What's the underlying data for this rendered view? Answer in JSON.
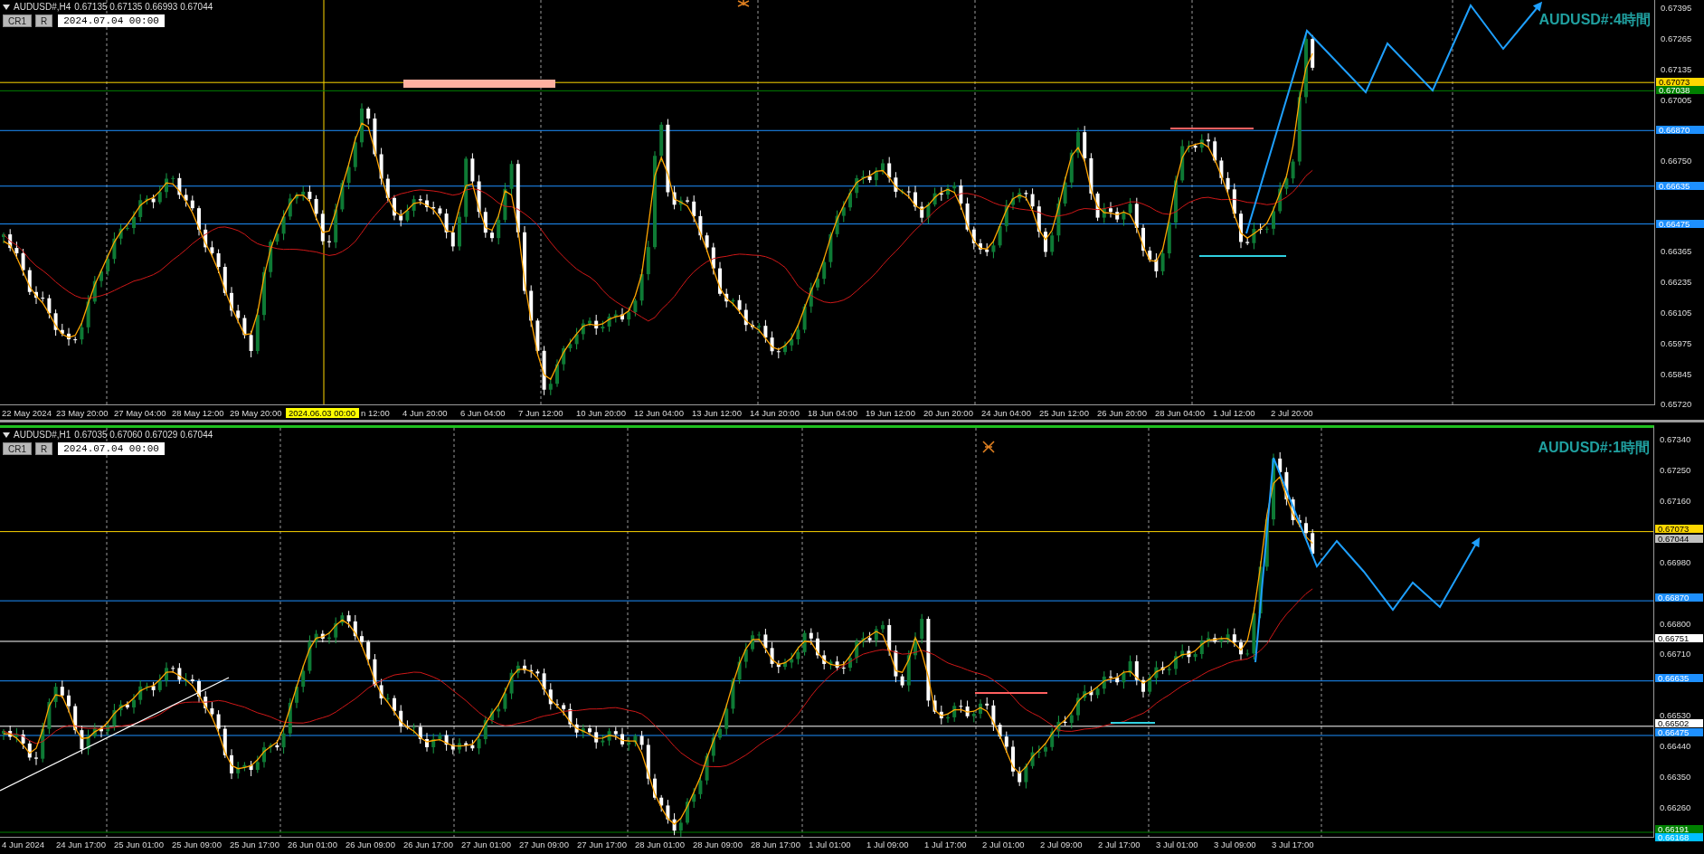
{
  "panels": [
    {
      "symbol": "AUDUSD#,H4",
      "ohlc": "0.67135 0.67135 0.66993 0.67044",
      "buttons": [
        "CR1",
        "R"
      ],
      "date_field": "2024.07.04 00:00",
      "title": "AUDUSD#:4時間",
      "price_ticks": [
        "0.67395",
        "0.67265",
        "0.67135",
        "0.67005",
        "0.66750",
        "0.66365",
        "0.66235",
        "0.66105",
        "0.65975",
        "0.65845",
        "0.65720"
      ],
      "price_labels": [
        {
          "value": "0.67073",
          "color": "#ffd700",
          "kind": "level"
        },
        {
          "value": "0.67038",
          "color": "#008000",
          "kind": "level"
        },
        {
          "value": "0.66870",
          "color": "#1e90ff",
          "kind": "level"
        },
        {
          "value": "0.66635",
          "color": "#1e90ff",
          "kind": "level"
        },
        {
          "value": "0.66475",
          "color": "#1e90ff",
          "kind": "level"
        }
      ],
      "time_labels": [
        {
          "text": "22 May 2024",
          "kind": "first"
        },
        {
          "text": "23 May 20:00",
          "kind": "date"
        },
        {
          "text": "27 May 04:00",
          "kind": "date"
        },
        {
          "text": "28 May 12:00",
          "kind": "date"
        },
        {
          "text": "29 May 20:00",
          "kind": "date"
        },
        {
          "text": "2024.06.03 00:00",
          "kind": "crosshair"
        },
        {
          "text": "n 12:00",
          "kind": "partial"
        },
        {
          "text": "4 Jun 20:00",
          "kind": "date"
        },
        {
          "text": "6 Jun 04:00",
          "kind": "date"
        },
        {
          "text": "7 Jun 12:00",
          "kind": "date"
        },
        {
          "text": "10 Jun 20:00",
          "kind": "date"
        },
        {
          "text": "12 Jun 04:00",
          "kind": "date"
        },
        {
          "text": "13 Jun 12:00",
          "kind": "date"
        },
        {
          "text": "14 Jun 20:00",
          "kind": "date"
        },
        {
          "text": "18 Jun 04:00",
          "kind": "date"
        },
        {
          "text": "19 Jun 12:00",
          "kind": "date"
        },
        {
          "text": "20 Jun 20:00",
          "kind": "date"
        },
        {
          "text": "24 Jun 04:00",
          "kind": "date"
        },
        {
          "text": "25 Jun 12:00",
          "kind": "date"
        },
        {
          "text": "26 Jun 20:00",
          "kind": "date"
        },
        {
          "text": "28 Jun 04:00",
          "kind": "date"
        },
        {
          "text": "1 Jul 12:00",
          "kind": "date"
        },
        {
          "text": "2 Jul 20:00",
          "kind": "date"
        }
      ]
    },
    {
      "symbol": "AUDUSD#,H1",
      "ohlc": "0.67035 0.67060 0.67029 0.67044",
      "buttons": [
        "CR1",
        "R"
      ],
      "date_field": "2024.07.04 00:00",
      "title": "AUDUSD#:1時間",
      "price_ticks": [
        "0.67340",
        "0.67250",
        "0.67160",
        "0.66980",
        "0.66800",
        "0.66710",
        "0.66530",
        "0.66440",
        "0.66350",
        "0.66260"
      ],
      "price_labels": [
        {
          "value": "0.67073",
          "color": "#ffd700",
          "kind": "level"
        },
        {
          "value": "0.67044",
          "color": "#c0c0c0",
          "kind": "marker"
        },
        {
          "value": "0.66870",
          "color": "#1e90ff",
          "kind": "level"
        },
        {
          "value": "0.66751",
          "color": "#ffffff",
          "kind": "level"
        },
        {
          "value": "0.66635",
          "color": "#1e90ff",
          "kind": "level"
        },
        {
          "value": "0.66502",
          "color": "#ffffff",
          "kind": "level"
        },
        {
          "value": "0.66475",
          "color": "#1e90ff",
          "kind": "level"
        },
        {
          "value": "0.66191",
          "color": "#008000",
          "kind": "level"
        },
        {
          "value": "0.66168",
          "color": "#00bfff",
          "kind": "level"
        }
      ],
      "time_labels": [
        {
          "text": "4 Jun 2024",
          "kind": "first"
        },
        {
          "text": "24 Jun 17:00",
          "kind": "date"
        },
        {
          "text": "25 Jun 01:00",
          "kind": "date"
        },
        {
          "text": "25 Jun 09:00",
          "kind": "date"
        },
        {
          "text": "25 Jun 17:00",
          "kind": "date"
        },
        {
          "text": "26 Jun 01:00",
          "kind": "date"
        },
        {
          "text": "26 Jun 09:00",
          "kind": "date"
        },
        {
          "text": "26 Jun 17:00",
          "kind": "date"
        },
        {
          "text": "27 Jun 01:00",
          "kind": "date"
        },
        {
          "text": "27 Jun 09:00",
          "kind": "date"
        },
        {
          "text": "27 Jun 17:00",
          "kind": "date"
        },
        {
          "text": "28 Jun 01:00",
          "kind": "date"
        },
        {
          "text": "28 Jun 09:00",
          "kind": "date"
        },
        {
          "text": "28 Jun 17:00",
          "kind": "date"
        },
        {
          "text": "1 Jul 01:00",
          "kind": "date"
        },
        {
          "text": "1 Jul 09:00",
          "kind": "date"
        },
        {
          "text": "1 Jul 17:00",
          "kind": "date"
        },
        {
          "text": "2 Jul 01:00",
          "kind": "date"
        },
        {
          "text": "2 Jul 09:00",
          "kind": "date"
        },
        {
          "text": "2 Jul 17:00",
          "kind": "date"
        },
        {
          "text": "3 Jul 01:00",
          "kind": "date"
        },
        {
          "text": "3 Jul 09:00",
          "kind": "date"
        },
        {
          "text": "3 Jul 17:00",
          "kind": "date"
        }
      ]
    }
  ]
}
